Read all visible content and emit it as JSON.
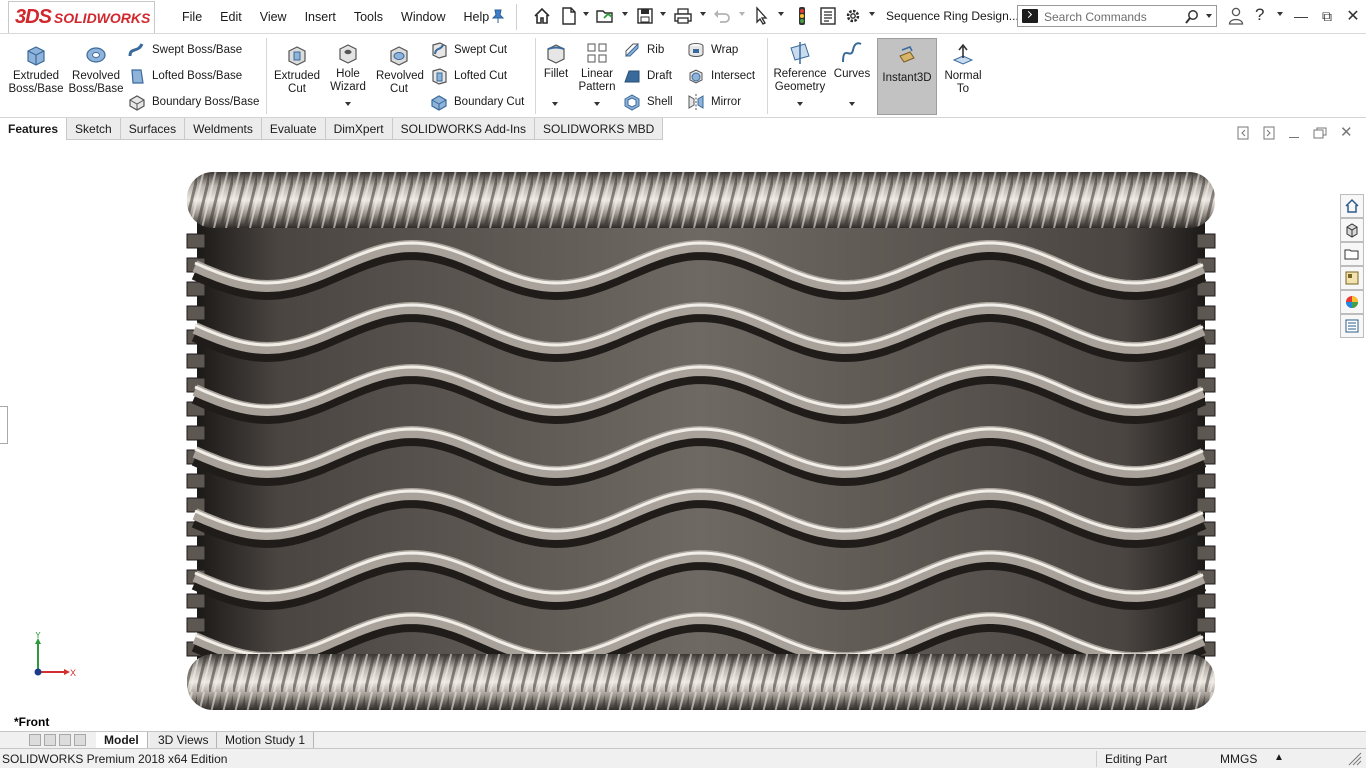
{
  "app": {
    "logo_prefix": "3DS",
    "logo_text": "SOLIDWORKS",
    "document_title": "Sequence Ring Design..."
  },
  "menu": [
    "File",
    "Edit",
    "View",
    "Insert",
    "Tools",
    "Window",
    "Help"
  ],
  "search": {
    "placeholder": "Search Commands"
  },
  "ribbon": {
    "extruded_boss": "Extruded Boss/Base",
    "revolved_boss": "Revolved Boss/Base",
    "swept_boss": "Swept Boss/Base",
    "lofted_boss": "Lofted Boss/Base",
    "boundary_boss": "Boundary Boss/Base",
    "extruded_cut": "Extruded Cut",
    "hole_wizard": "Hole Wizard",
    "revolved_cut": "Revolved Cut",
    "swept_cut": "Swept Cut",
    "lofted_cut": "Lofted Cut",
    "boundary_cut": "Boundary Cut",
    "fillet": "Fillet",
    "linear_pattern": "Linear Pattern",
    "rib": "Rib",
    "draft": "Draft",
    "shell": "Shell",
    "wrap": "Wrap",
    "intersect": "Intersect",
    "mirror": "Mirror",
    "reference_geometry": "Reference Geometry",
    "curves": "Curves",
    "instant3d": "Instant3D",
    "normal_to": "Normal To"
  },
  "command_tabs": [
    "Features",
    "Sketch",
    "Surfaces",
    "Weldments",
    "Evaluate",
    "DimXpert",
    "SOLIDWORKS Add-Ins",
    "SOLIDWORKS MBD"
  ],
  "active_command_tab": "Features",
  "viewport": {
    "view_name": "*Front",
    "triad_y": "Y",
    "triad_x": "X"
  },
  "bottom_tabs": [
    "Model",
    "3D Views",
    "Motion Study 1"
  ],
  "active_bottom_tab": "Model",
  "status": {
    "edition": "SOLIDWORKS Premium 2018 x64 Edition",
    "mode": "Editing Part",
    "units": "MMGS"
  },
  "colors": {
    "brand_red": "#d0282e",
    "instant3d_active": "#c2c2c2",
    "ring_metal": "#8a8580"
  },
  "icons": [
    "home-icon",
    "new-document-icon",
    "open-icon",
    "save-icon",
    "print-icon",
    "undo-icon",
    "select-icon",
    "rebuild-icon",
    "file-properties-icon",
    "options-icon",
    "user-icon",
    "help-icon"
  ]
}
